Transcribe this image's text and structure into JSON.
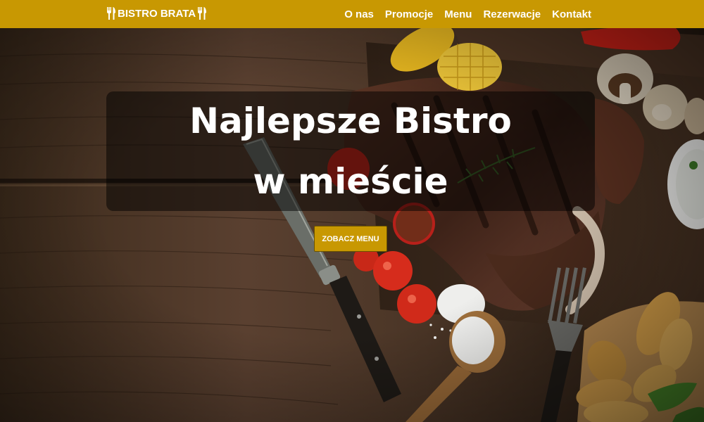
{
  "navbar": {
    "brand": "BISTRO BRATA",
    "links": [
      "O nas",
      "Promocje",
      "Menu",
      "Rezerwacje",
      "Kontakt"
    ],
    "background": "#c89802"
  },
  "hero": {
    "title_line1": "Najlepsze Bistro",
    "title_line2": "w mieście",
    "cta_label": "ZOBACZ MENU"
  },
  "icons": {
    "brand_left": "fork-knife-icon",
    "brand_right": "fork-knife-icon"
  }
}
